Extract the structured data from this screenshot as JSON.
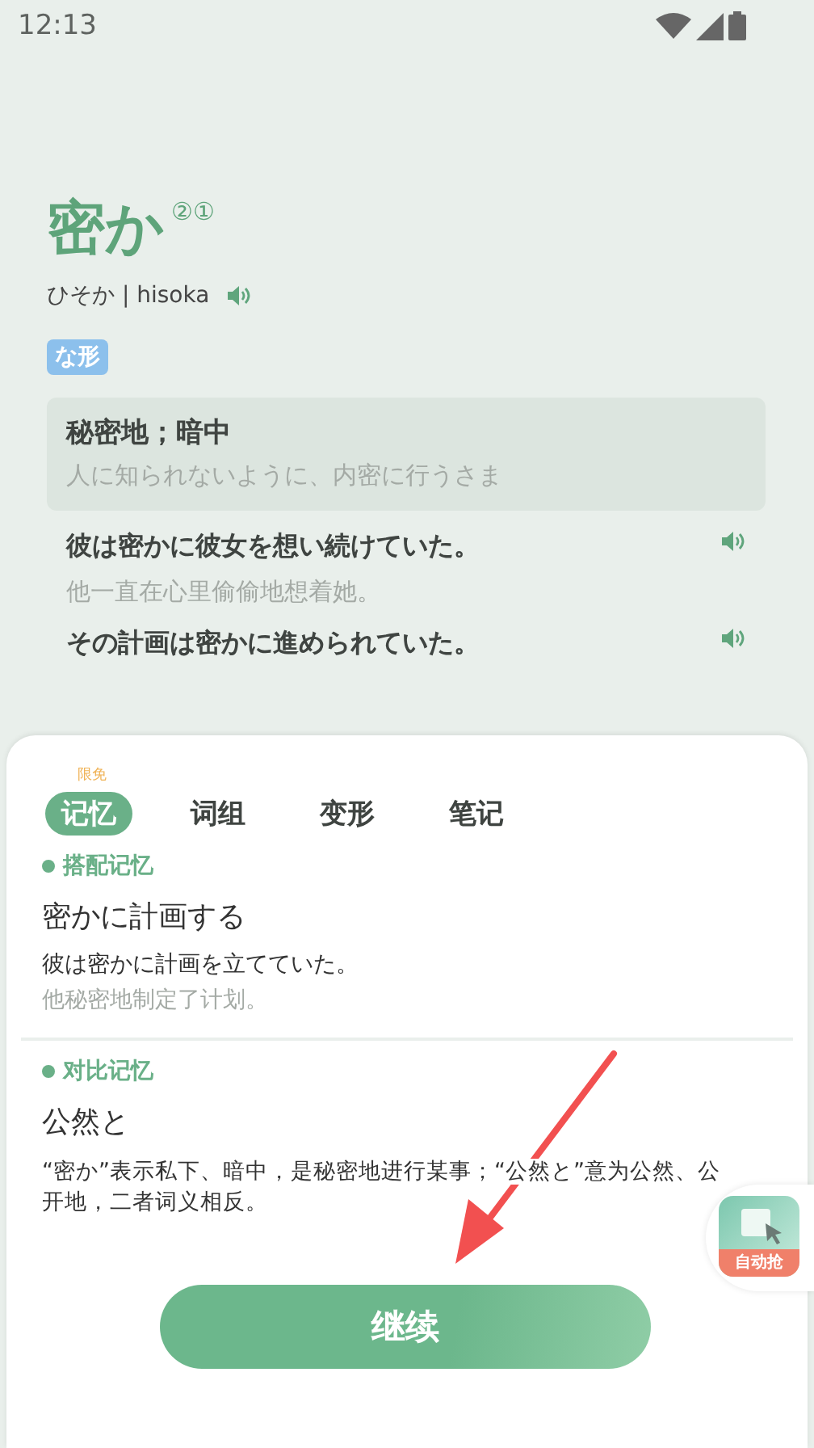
{
  "status_bar": {
    "time": "12:13"
  },
  "word": {
    "headword": "密か",
    "accent_marks": "②①",
    "reading": "ひそか | hisoka",
    "pos_tag": "な形"
  },
  "definition": {
    "meaning": "秘密地；暗中",
    "explanation": "人に知られないように、内密に行うさま"
  },
  "examples": [
    {
      "sentence": "彼は密かに彼女を想い続けていた。",
      "translation": "他一直在心里偷偷地想着她。"
    },
    {
      "sentence": "その計画は密かに進められていた。"
    }
  ],
  "sheet": {
    "badge": "限免",
    "tabs": [
      {
        "label": "记忆",
        "selected": true
      },
      {
        "label": "词组",
        "selected": false
      },
      {
        "label": "变形",
        "selected": false
      },
      {
        "label": "笔记",
        "selected": false
      }
    ],
    "sections": [
      {
        "kind": "example",
        "title": "搭配记忆",
        "phrase": "密かに計画する",
        "example": "彼は密かに計画を立てていた。",
        "translation": "他秘密地制定了计划。"
      },
      {
        "kind": "explanation",
        "title": "对比记忆",
        "phrase": "公然と",
        "explanation": "“密か”表示私下、暗中，是秘密地进行某事；“公然と”意为公然、公开地，二者词义相反。"
      }
    ],
    "button": "继续"
  },
  "floating_widget": {
    "label": "自动抢"
  }
}
